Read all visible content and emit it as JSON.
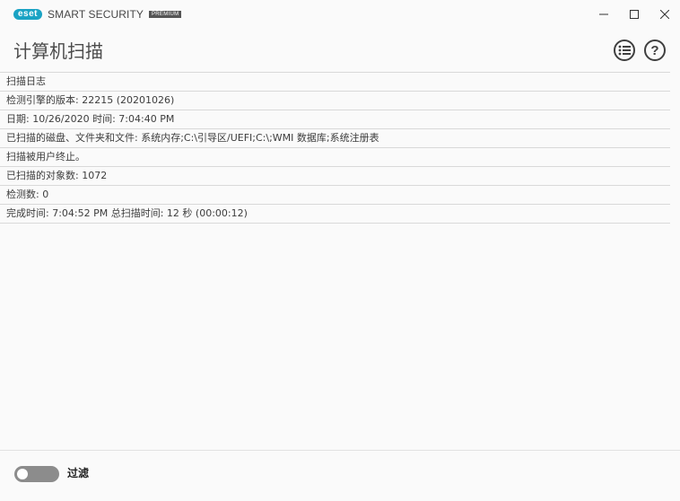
{
  "app": {
    "brand_badge": "eset",
    "product_name": "SMART SECURITY",
    "edition": "PREMIUM"
  },
  "window_controls": {
    "minimize_icon": "minimize-icon",
    "maximize_icon": "maximize-icon",
    "close_icon": "close-icon"
  },
  "header": {
    "title": "计算机扫描",
    "menu_icon": "list-icon",
    "help_label": "?"
  },
  "log": {
    "rows": [
      "扫描日志",
      "检测引擎的版本: 22215 (20201026)",
      "日期: 10/26/2020  时间: 7:04:40 PM",
      "已扫描的磁盘、文件夹和文件: 系统内存;C:\\引导区/UEFI;C:\\;WMI 数据库;系统注册表",
      "扫描被用户终止。",
      "已扫描的对象数: 1072",
      "检测数: 0",
      "完成时间: 7:04:52 PM  总扫描时间: 12 秒 (00:00:12)"
    ]
  },
  "footer": {
    "filter_label": "过滤",
    "filter_enabled": false
  },
  "colors": {
    "brand": "#1aa3c4",
    "toggle_off": "#8c8c8c"
  }
}
